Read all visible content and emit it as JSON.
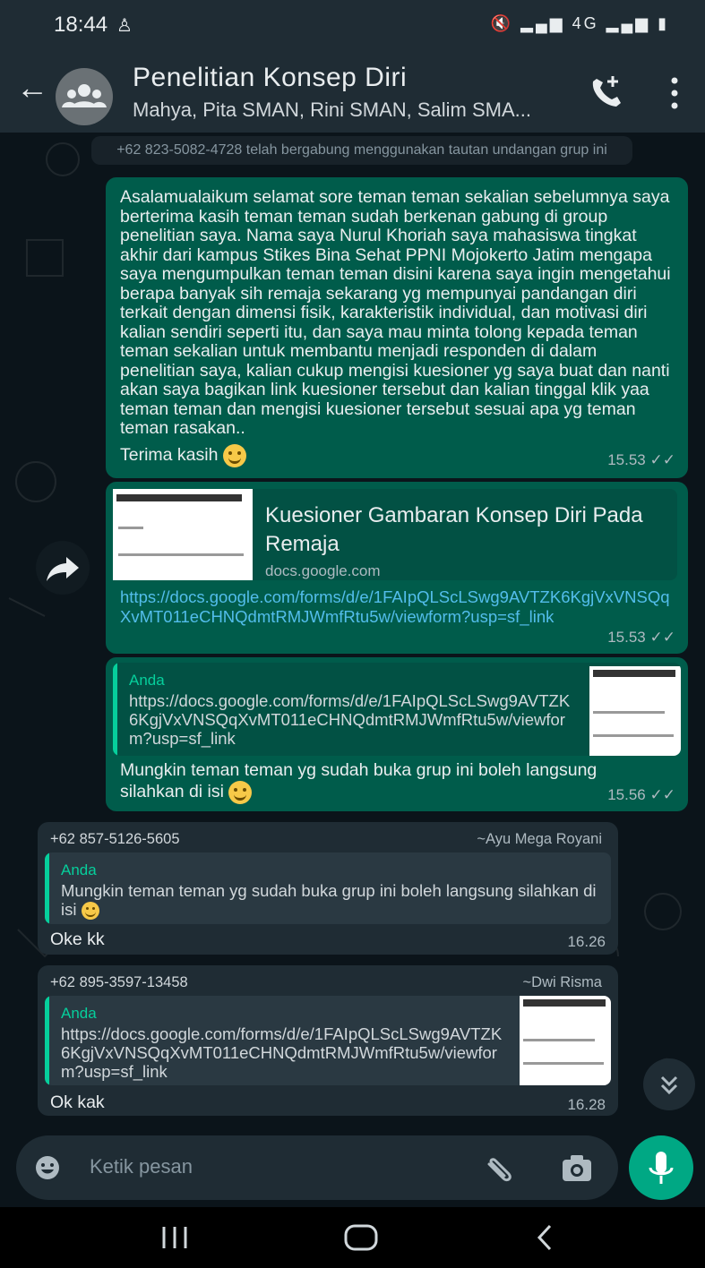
{
  "status_bar": {
    "time": "18:44",
    "signal_text": "4G"
  },
  "header": {
    "title": "Penelitian Konsep Diri",
    "subtitle": "Mahya, Pita SMAN, Rini SMAN, Salim SMA..."
  },
  "system_message": "+62 823-5082-4728 telah bergabung menggunakan tautan undangan grup ini",
  "messages": {
    "m1": {
      "text": "Asalamualaikum selamat sore teman teman sekalian sebelumnya saya  berterima kasih teman teman sudah berkenan gabung di group penelitian saya. Nama saya Nurul Khoriah saya mahasiswa tingkat akhir dari kampus Stikes Bina Sehat PPNI Mojokerto Jatim mengapa saya mengumpulkan teman teman disini karena saya ingin mengetahui berapa banyak sih remaja sekarang yg mempunyai pandangan diri terkait dengan dimensi fisik, karakteristik individual, dan motivasi diri kalian sendiri seperti itu, dan saya mau minta tolong kepada teman teman sekalian untuk membantu menjadi responden di dalam penelitian saya, kalian cukup mengisi kuesioner yg saya buat dan nanti akan saya bagikan link kuesioner tersebut dan kalian tinggal klik yaa teman teman dan mengisi kuesioner tersebut sesuai apa yg teman teman rasakan..",
      "closing": "Terima kasih",
      "time": "15.53"
    },
    "m2": {
      "link_title": "Kuesioner Gambaran Konsep Diri Pada Remaja",
      "domain": "docs.google.com",
      "url": "https://docs.google.com/forms/d/e/1FAIpQLScLSwg9AVTZK6KgjVxVNSQqXvMT011eCHNQdmtRMJWmfRtu5w/viewform?usp=sf_link",
      "time": "15.53"
    },
    "m3": {
      "quote_author": "Anda",
      "quote_text": "https://docs.google.com/forms/d/e/1FAIpQLScLSwg9AVTZK6KgjVxVNSQqXvMT011eCHNQdmtRMJWmfRtu5w/viewform?usp=sf_link",
      "text": "Mungkin teman teman yg sudah buka grup ini boleh langsung silahkan di isi",
      "time": "15.56"
    },
    "m4": {
      "sender_phone": "+62 857-5126-5605",
      "sender_name": "~Ayu Mega Royani",
      "quote_author": "Anda",
      "quote_text": "Mungkin teman teman yg sudah buka grup ini boleh langsung silahkan di isi",
      "text": "Oke kk",
      "time": "16.26"
    },
    "m5": {
      "sender_phone": "+62 895-3597-13458",
      "sender_name": "~Dwi Risma",
      "quote_author": "Anda",
      "quote_text": "https://docs.google.com/forms/d/e/1FAIpQLScLSwg9AVTZK6KgjVxVNSQqXvMT011eCHNQdmtRMJWmfRtu5w/viewform?usp=sf_link",
      "text": "Ok kak",
      "time": "16.28"
    }
  },
  "input": {
    "placeholder": "Ketik pesan"
  },
  "colors": {
    "outgoing_bubble": "#005c4b",
    "incoming_bubble": "#1f2c34",
    "accent": "#00a884",
    "link": "#53bdeb"
  }
}
